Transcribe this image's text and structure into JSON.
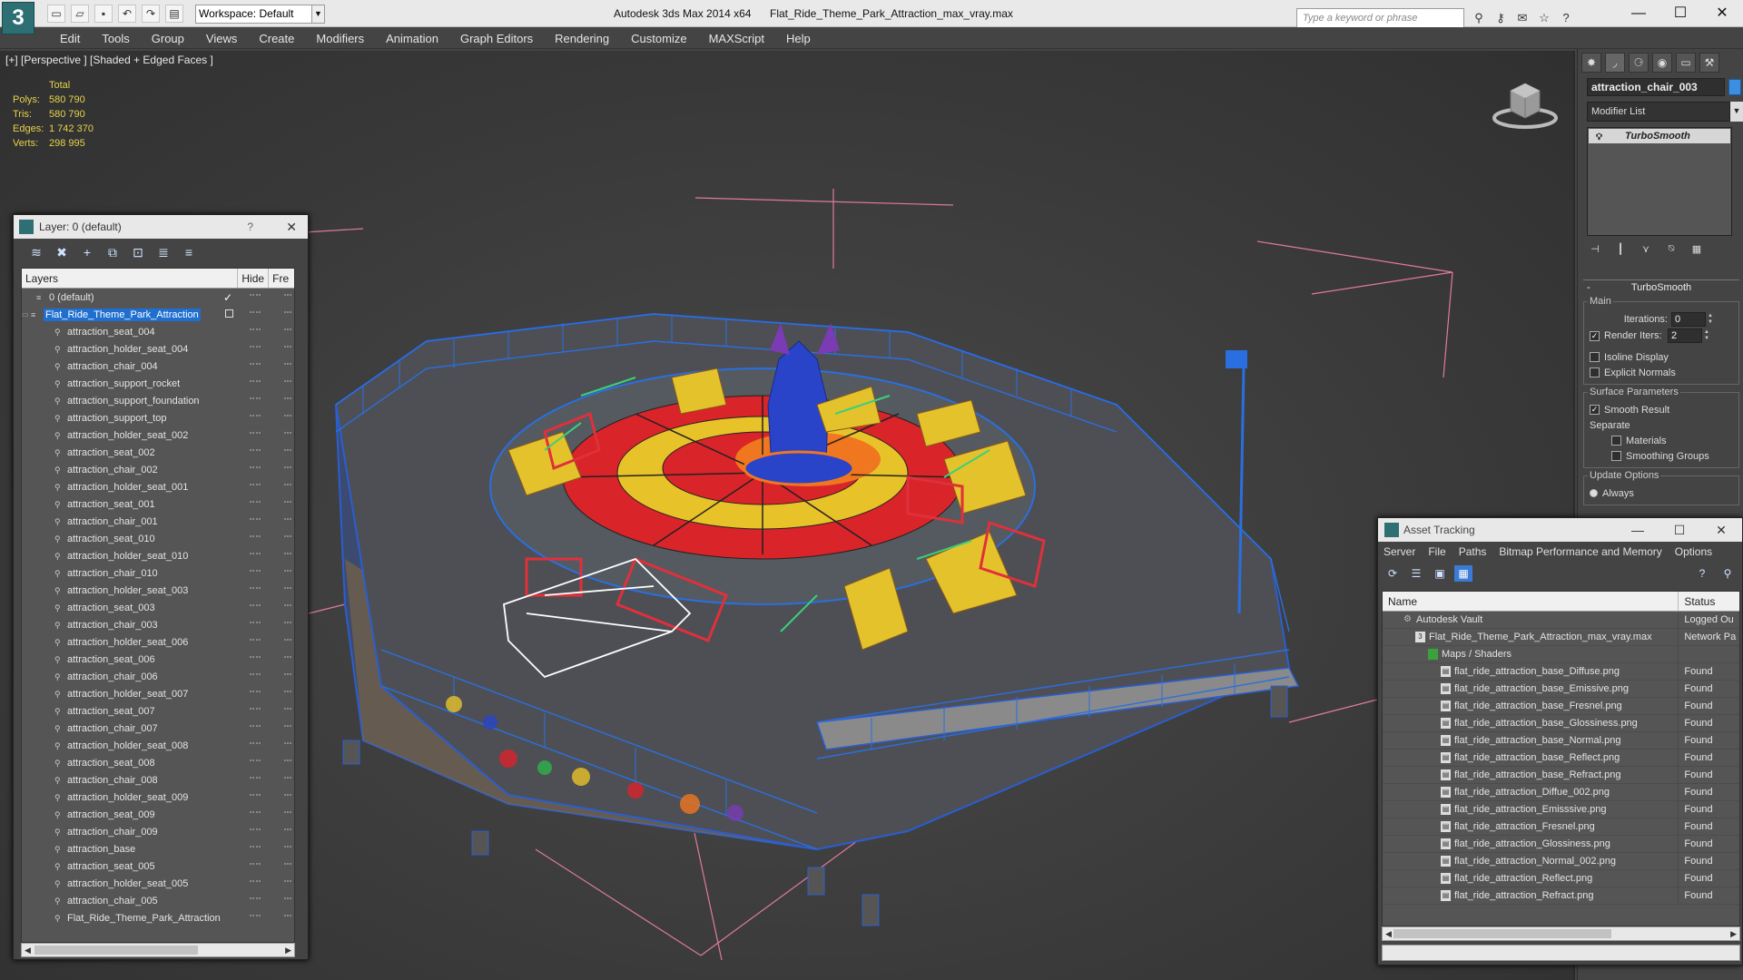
{
  "titlebar": {
    "app_title": "Autodesk 3ds Max  2014 x64",
    "doc_title": "Flat_Ride_Theme_Park_Attraction_max_vray.max",
    "workspace": "Workspace: Default",
    "search_placeholder": "Type a keyword or phrase"
  },
  "menu": [
    "Edit",
    "Tools",
    "Group",
    "Views",
    "Create",
    "Modifiers",
    "Animation",
    "Graph Editors",
    "Rendering",
    "Customize",
    "MAXScript",
    "Help"
  ],
  "viewport": {
    "label": "[+] [Perspective ] [Shaded + Edged Faces ]",
    "stats": {
      "header": "Total",
      "rows": [
        {
          "label": "Polys:",
          "value": "580 790"
        },
        {
          "label": "Tris:",
          "value": "580 790"
        },
        {
          "label": "Edges:",
          "value": "1 742 370"
        },
        {
          "label": "Verts:",
          "value": "298 995"
        }
      ]
    }
  },
  "layer_explorer": {
    "title": "Layer: 0 (default)",
    "help": "?",
    "columns": {
      "layers": "Layers",
      "hide": "Hide",
      "freeze": "Fre"
    },
    "default_layer": "0 (default)",
    "selected_layer": "Flat_Ride_Theme_Park_Attraction",
    "items": [
      "attraction_seat_004",
      "attraction_holder_seat_004",
      "attraction_chair_004",
      "attraction_support_rocket",
      "attraction_support_foundation",
      "attraction_support_top",
      "attraction_holder_seat_002",
      "attraction_seat_002",
      "attraction_chair_002",
      "attraction_holder_seat_001",
      "attraction_seat_001",
      "attraction_chair_001",
      "attraction_seat_010",
      "attraction_holder_seat_010",
      "attraction_chair_010",
      "attraction_holder_seat_003",
      "attraction_seat_003",
      "attraction_chair_003",
      "attraction_holder_seat_006",
      "attraction_seat_006",
      "attraction_chair_006",
      "attraction_holder_seat_007",
      "attraction_seat_007",
      "attraction_chair_007",
      "attraction_holder_seat_008",
      "attraction_seat_008",
      "attraction_chair_008",
      "attraction_holder_seat_009",
      "attraction_seat_009",
      "attraction_chair_009",
      "attraction_base",
      "attraction_seat_005",
      "attraction_holder_seat_005",
      "attraction_chair_005",
      "Flat_Ride_Theme_Park_Attraction"
    ]
  },
  "command_panel": {
    "object_name": "attraction_chair_003",
    "object_color": "#3a8fe3",
    "modifier_list": "Modifier List",
    "stack_item": "TurboSmooth",
    "rollout_title": "TurboSmooth",
    "main_group": "Main",
    "iterations_label": "Iterations:",
    "iterations_value": "0",
    "render_iters_label": "Render Iters:",
    "render_iters_value": "2",
    "isoline": "Isoline Display",
    "explicit_normals": "Explicit Normals",
    "surface_group": "Surface Parameters",
    "smooth_result": "Smooth Result",
    "separate": "Separate",
    "materials": "Materials",
    "smoothing_groups": "Smoothing Groups",
    "update_group": "Update Options",
    "always": "Always"
  },
  "asset_tracking": {
    "title": "Asset Tracking",
    "menu": [
      "Server",
      "File",
      "Paths",
      "Bitmap Performance and Memory",
      "Options"
    ],
    "columns": {
      "name": "Name",
      "status": "Status"
    },
    "vault": {
      "name": "Autodesk Vault",
      "status": "Logged Ou"
    },
    "file": {
      "name": "Flat_Ride_Theme_Park_Attraction_max_vray.max",
      "status": "Network Pa"
    },
    "maps": {
      "name": "Maps / Shaders",
      "status": ""
    },
    "assets": [
      {
        "name": "flat_ride_attraction_base_Diffuse.png",
        "status": "Found"
      },
      {
        "name": "flat_ride_attraction_base_Emissive.png",
        "status": "Found"
      },
      {
        "name": "flat_ride_attraction_base_Fresnel.png",
        "status": "Found"
      },
      {
        "name": "flat_ride_attraction_base_Glossiness.png",
        "status": "Found"
      },
      {
        "name": "flat_ride_attraction_base_Normal.png",
        "status": "Found"
      },
      {
        "name": "flat_ride_attraction_base_Reflect.png",
        "status": "Found"
      },
      {
        "name": "flat_ride_attraction_base_Refract.png",
        "status": "Found"
      },
      {
        "name": "flat_ride_attraction_Diffue_002.png",
        "status": "Found"
      },
      {
        "name": "flat_ride_attraction_Emisssive.png",
        "status": "Found"
      },
      {
        "name": "flat_ride_attraction_Fresnel.png",
        "status": "Found"
      },
      {
        "name": "flat_ride_attraction_Glossiness.png",
        "status": "Found"
      },
      {
        "name": "flat_ride_attraction_Normal_002.png",
        "status": "Found"
      },
      {
        "name": "flat_ride_attraction_Reflect.png",
        "status": "Found"
      },
      {
        "name": "flat_ride_attraction_Refract.png",
        "status": "Found"
      }
    ]
  }
}
